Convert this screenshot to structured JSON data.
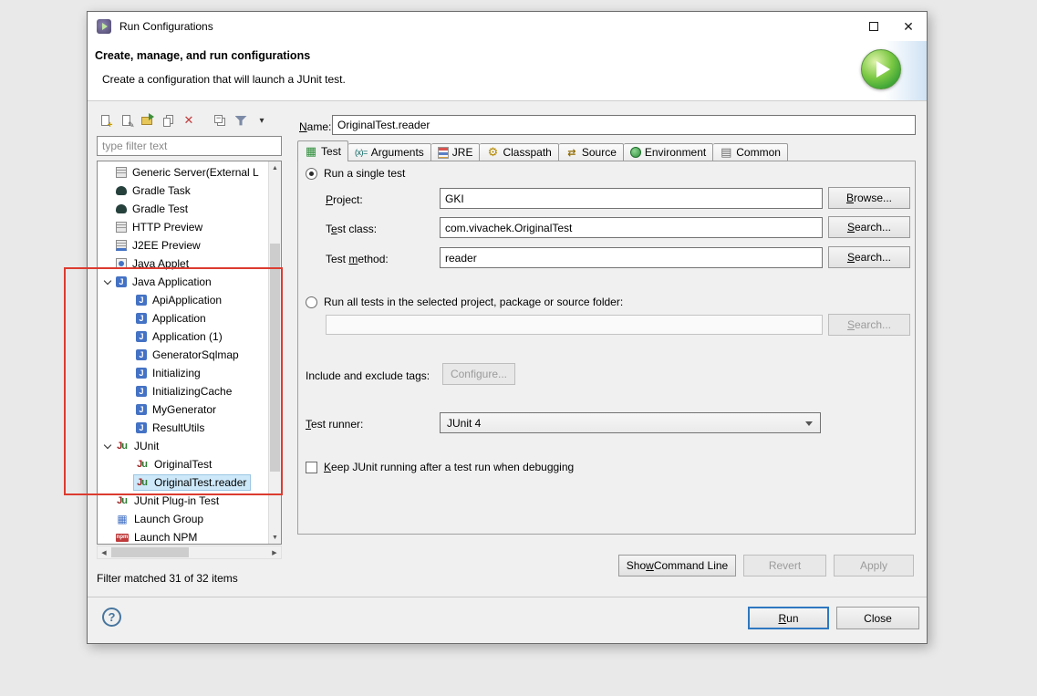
{
  "window": {
    "title": "Run Configurations"
  },
  "header": {
    "title": "Create, manage, and run configurations",
    "subtitle": "Create a configuration that will launch a JUnit test."
  },
  "sidebar": {
    "filter_placeholder": "type filter text",
    "status": "Filter matched 31 of 32 items",
    "tree": [
      {
        "label": "Generic Server(External L",
        "icon": "server",
        "level": 0
      },
      {
        "label": "Gradle Task",
        "icon": "gradle",
        "level": 0
      },
      {
        "label": "Gradle Test",
        "icon": "gradle",
        "level": 0
      },
      {
        "label": "HTTP Preview",
        "icon": "server",
        "level": 0
      },
      {
        "label": "J2EE Preview",
        "icon": "j2ee",
        "level": 0
      },
      {
        "label": "Java Applet",
        "icon": "applet",
        "level": 0
      },
      {
        "label": "Java Application",
        "icon": "java-app",
        "level": 0,
        "expanded": true
      },
      {
        "label": "ApiApplication",
        "icon": "java-app",
        "level": 1
      },
      {
        "label": "Application",
        "icon": "java-app",
        "level": 1
      },
      {
        "label": "Application (1)",
        "icon": "java-app",
        "level": 1
      },
      {
        "label": "GeneratorSqlmap",
        "icon": "java-app",
        "level": 1
      },
      {
        "label": "Initializing",
        "icon": "java-app",
        "level": 1
      },
      {
        "label": "InitializingCache",
        "icon": "java-app",
        "level": 1
      },
      {
        "label": "MyGenerator",
        "icon": "java-app",
        "level": 1
      },
      {
        "label": "ResultUtils",
        "icon": "java-app",
        "level": 1
      },
      {
        "label": "JUnit",
        "icon": "junit",
        "level": 0,
        "expanded": true
      },
      {
        "label": "OriginalTest",
        "icon": "junit",
        "level": 1
      },
      {
        "label": "OriginalTest.reader",
        "icon": "junit",
        "level": 1,
        "selected": true
      },
      {
        "label": "JUnit Plug-in Test",
        "icon": "junit-plugin",
        "level": 0
      },
      {
        "label": "Launch Group",
        "icon": "launch-group",
        "level": 0
      },
      {
        "label": "Launch NPM",
        "icon": "npm",
        "level": 0
      }
    ]
  },
  "main": {
    "name_label": "&Name:",
    "name_value": "OriginalTest.reader",
    "tabs": [
      {
        "label": "Test",
        "icon": "test",
        "active": true
      },
      {
        "label": "Arguments",
        "icon": "arguments"
      },
      {
        "label": "JRE",
        "icon": "jre"
      },
      {
        "label": "Classpath",
        "icon": "classpath"
      },
      {
        "label": "Source",
        "icon": "source"
      },
      {
        "label": "Environment",
        "icon": "environment"
      },
      {
        "label": "Common",
        "icon": "common"
      }
    ],
    "test_tab": {
      "single_radio": "Run a single test",
      "single_radio_selected": true,
      "project_label": "&Project:",
      "project_value": "GKI",
      "browse_button": "&Browse...",
      "test_class_label": "T&est class:",
      "test_class_value": "com.vivachek.OriginalTest",
      "search_button": "&Search...",
      "test_method_label": "Test &method:",
      "test_method_value": "reader",
      "all_radio": "Run all tests in the selected project, package or source folder:",
      "all_radio_selected": false,
      "all_value": "",
      "tags_label": "Include and exclude tags:",
      "configure_button": "Configure...",
      "runner_label": "&Test runner:",
      "runner_value": "JUnit 4",
      "keep_checkbox": "&Keep JUnit running after a test run when debugging",
      "keep_checked": false
    },
    "actions": {
      "show_command_line": "Sho&w Command Line",
      "revert": "Revert",
      "apply": "Apply"
    }
  },
  "footer": {
    "run": "&Run",
    "close": "Close"
  }
}
